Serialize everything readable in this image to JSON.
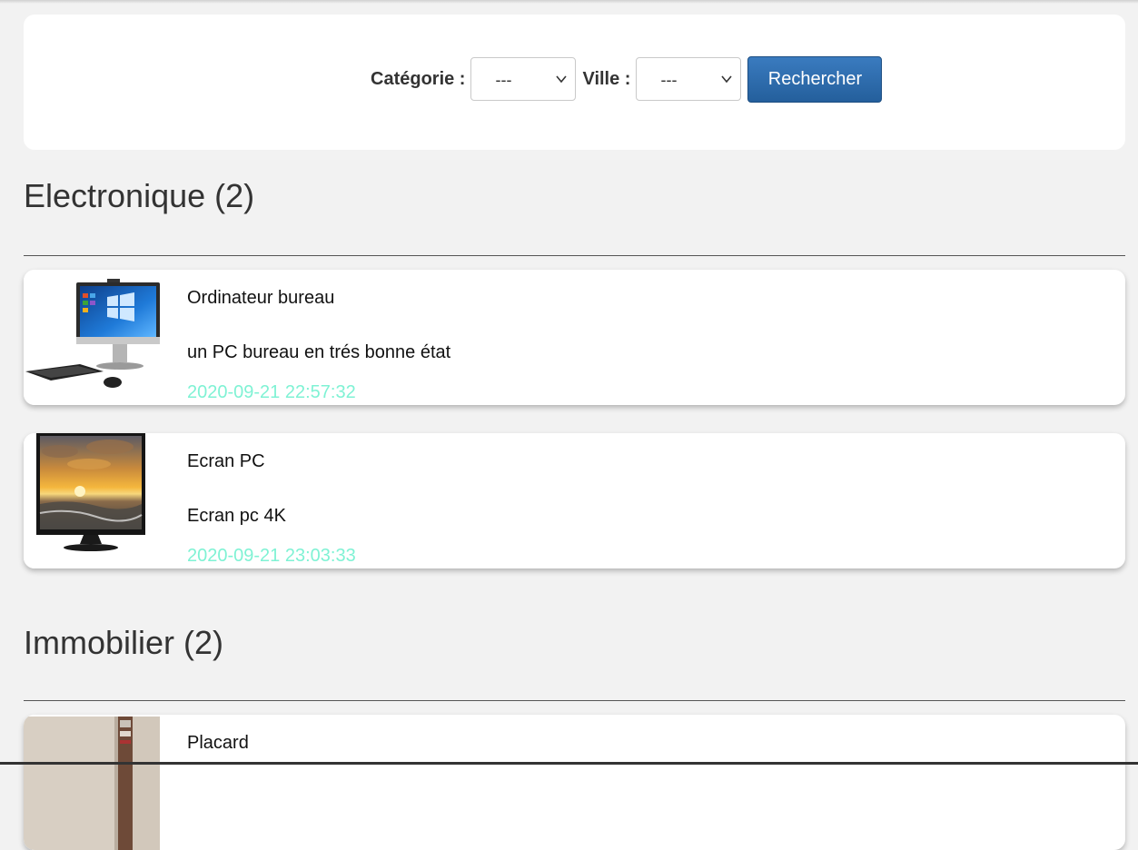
{
  "search": {
    "category_label": "Catégorie :",
    "category_value": "---",
    "city_label": "Ville :",
    "city_value": "---",
    "submit_label": "Rechercher"
  },
  "sections": [
    {
      "title": "Electronique (2)",
      "items": [
        {
          "title": "Ordinateur bureau",
          "description": "un PC bureau en trés bonne état",
          "date": "2020-09-21 22:57:32",
          "image": "all-in-one-desktop-computer-photo"
        },
        {
          "title": "Ecran PC",
          "description": "Ecran pc 4K",
          "date": "2020-09-21 23:03:33",
          "image": "pc-monitor-sunset-photo"
        }
      ]
    },
    {
      "title": "Immobilier (2)",
      "items": [
        {
          "title": "Placard",
          "image": "wooden-wardrobe-photo"
        }
      ]
    }
  ],
  "colors": {
    "page_background": "#f2f2f2",
    "button_blue": "#2b6cb0",
    "date_text": "#7ff2d4"
  }
}
